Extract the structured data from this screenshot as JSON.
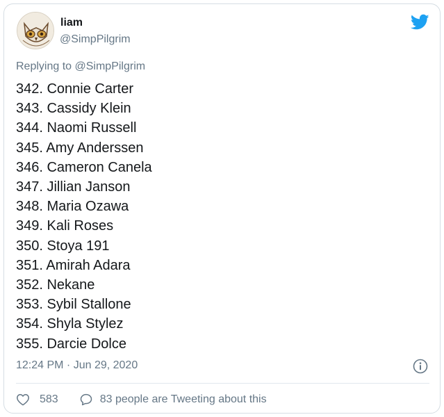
{
  "tweet": {
    "author": {
      "display_name": "liam",
      "handle": "@SimpPilgrim"
    },
    "reply_prefix": "Replying to",
    "reply_to": "@SimpPilgrim",
    "lines": [
      "342. Connie Carter",
      "343. Cassidy Klein",
      "344. Naomi Russell",
      "345. Amy Anderssen",
      "346. Cameron Canela",
      "347. Jillian Janson",
      "348. Maria Ozawa",
      "349. Kali Roses",
      "350. Stoya 191",
      "351. Amirah Adara",
      "352. Nekane",
      "353. Sybil Stallone",
      "354. Shyla Stylez",
      "355. Darcie Dolce"
    ],
    "timestamp": "12:24 PM · Jun 29, 2020",
    "like_count": "583",
    "reply_text": "83 people are Tweeting about this"
  },
  "icons": {
    "brand": "twitter-bird-icon",
    "info": "info-icon",
    "like": "heart-icon",
    "reply": "speech-bubble-icon"
  },
  "colors": {
    "brand_blue": "#1da1f2",
    "secondary_text": "#657786",
    "primary_text": "#14171a",
    "border": "#d5dde3"
  }
}
